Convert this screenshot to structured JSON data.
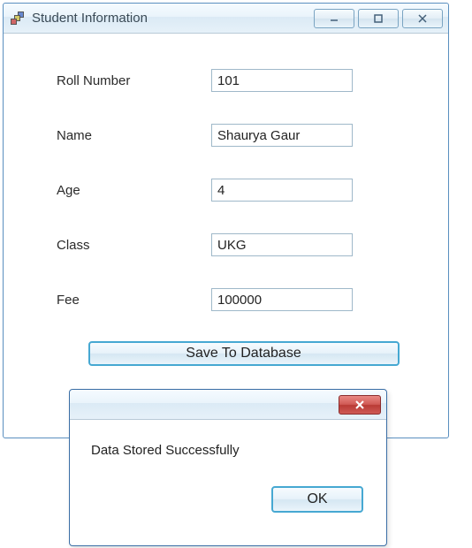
{
  "window": {
    "title": "Student Information"
  },
  "form": {
    "roll_number": {
      "label": "Roll Number",
      "value": "101"
    },
    "name": {
      "label": "Name",
      "value": "Shaurya Gaur"
    },
    "age": {
      "label": "Age",
      "value": "4"
    },
    "class": {
      "label": "Class",
      "value": "UKG"
    },
    "fee": {
      "label": "Fee",
      "value": "100000"
    }
  },
  "buttons": {
    "save": "Save To Database",
    "ok": "OK"
  },
  "dialog": {
    "message": "Data Stored Successfully"
  }
}
